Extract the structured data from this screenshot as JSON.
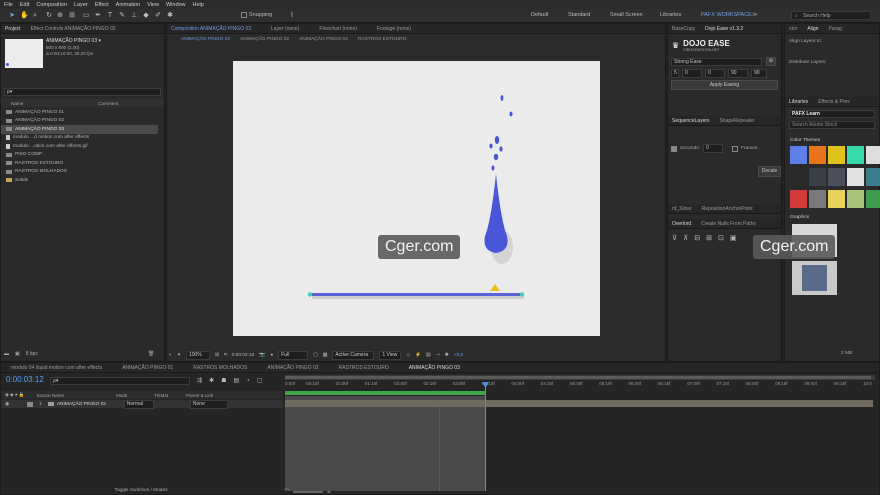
{
  "menu": [
    "File",
    "Edit",
    "Composition",
    "Layer",
    "Effect",
    "Animation",
    "View",
    "Window",
    "Help"
  ],
  "toolbar": {
    "snapping": "Snapping",
    "workspaces": [
      "Default",
      "Standard",
      "Small Screen",
      "Libraries"
    ],
    "active_workspace": "PAFX WORKSPACE",
    "search": "Search Help"
  },
  "project": {
    "tabs": [
      "Project",
      "Effect Controls ANIMAÇÃO PINGO 02"
    ],
    "selected_name": "ANIMAÇÃO PINGO 03 ▾",
    "info1": "500 x 800 (1,00)",
    "info2": "Δ 0:00:10:00, 30,00 fps",
    "search_placeholder": "ρ▾",
    "col_name": "Name",
    "col_comment": "Comment",
    "items": [
      "ANIMAÇÃO PINGO 01",
      "ANIMAÇÃO PINGO 02",
      "ANIMAÇÃO PINGO 03",
      "modulo ...d motion com after effects",
      "modulo ...otion com after effects.gif",
      "PISO COMP",
      "RASTROS ESTOURO",
      "RASTROS MOLHADOS",
      "Solids"
    ],
    "bpc": "8 bpc"
  },
  "composition": {
    "tabs": [
      "Composition ANIMAÇÃO PINGO 03",
      "Layer (none)",
      "Flowchart (none)",
      "Footage (none)"
    ],
    "breadcrumbs": [
      "ANIMAÇÃO PINGO 03",
      "ANIMAÇÃO PINGO 02",
      "ANIMAÇÃO PINGO 01",
      "RASTROS ESTOURO"
    ],
    "zoom": "100%",
    "time": "0:00:02:16",
    "resolution": "Full",
    "camera": "Active Camera",
    "views": "1 View",
    "exposure": "+0,0"
  },
  "right_panel": {
    "tabs_left": [
      "BaseCopy",
      "Dojo Ease v1.3.2"
    ],
    "dojo_title": "DOJO EASE",
    "dojo_sub": "CREATEMOTION.NET",
    "ease_select": "Strong Ease",
    "values": [
      "5",
      "0",
      "0",
      "90",
      "90"
    ],
    "apply": "Apply Easing",
    "tabs_seq": [
      "SequenceLayers",
      "ShapeRepeater"
    ],
    "seconds_label": "Seconds:",
    "seconds_value": "0",
    "frames_label": "Frames:",
    "decale": "Decale",
    "tabs_slicer": [
      "rd_Slicer",
      "RepositionAnchorPoint"
    ],
    "tabs_overlord": [
      "Overlord",
      "Create Nulls From Paths"
    ]
  },
  "far_right": {
    "tabs": [
      "ctor",
      "Align",
      "Parag"
    ],
    "align_to": "Align Layers to:",
    "distribute": "Distribute Layers:",
    "lib_tabs": [
      "Libraries",
      "Effects & Pres"
    ],
    "lib_select": "PAFX Learn",
    "lib_search": "Search Adobe Stock",
    "color_themes": "Color Themes",
    "graphics": "Graphics",
    "size": "2 MB",
    "swatches": [
      "#5c7fe8",
      "#e8741c",
      "#e0c21c",
      "#38d9a8",
      "#dddddd",
      "#2a2a2a",
      "#3b3f48",
      "#4a4f5a",
      "#e2e2e2",
      "#3b7d8c",
      "#d43a3a",
      "#7a7a7a",
      "#e8d35a",
      "#a8c27a",
      "#3d9a4e"
    ]
  },
  "timeline": {
    "tabs": [
      "modulo 04 liquid motion com after effects",
      "ANIMAÇÃO PINGO 01",
      "RASTROS MOLHADOS",
      "ANIMAÇÃO PINGO 02",
      "RASTROS ESTOURO",
      "ANIMAÇÃO PINGO 03"
    ],
    "timecode": "0:00:03:12",
    "search_placeholder": "ρ▾",
    "col_source": "Source Name",
    "col_mode": "Mode",
    "col_trkmat": "TrkMat",
    "col_parent": "Parent & Link",
    "layer_index": "1",
    "layer_name": "ANIMAÇÃO PINGO 02",
    "layer_mode": "Normal",
    "layer_parent": "None",
    "ruler": [
      "0:00f",
      "00:15f",
      "01:00f",
      "01:15f",
      "02:00f",
      "02:15f",
      "03:00f",
      "03:15f",
      "04:00f",
      "04:15f",
      "05:00f",
      "05:15f",
      "06:00f",
      "06:15f",
      "07:00f",
      "07:15f",
      "08:00f",
      "08:15f",
      "09:00f",
      "09:15f",
      "10:0"
    ],
    "toggle": "Toggle Switches / Modes"
  },
  "watermarks": [
    "Cger.com",
    "Cger.com"
  ],
  "colors": {
    "accent": "#4a8fe0",
    "drop": "#4a56d8",
    "bar": "#5a62d8",
    "bar_end": "#37d3b0",
    "triangle": "#e8c21a",
    "work_area": "#3fa64a",
    "playhead": "#c4303a"
  }
}
